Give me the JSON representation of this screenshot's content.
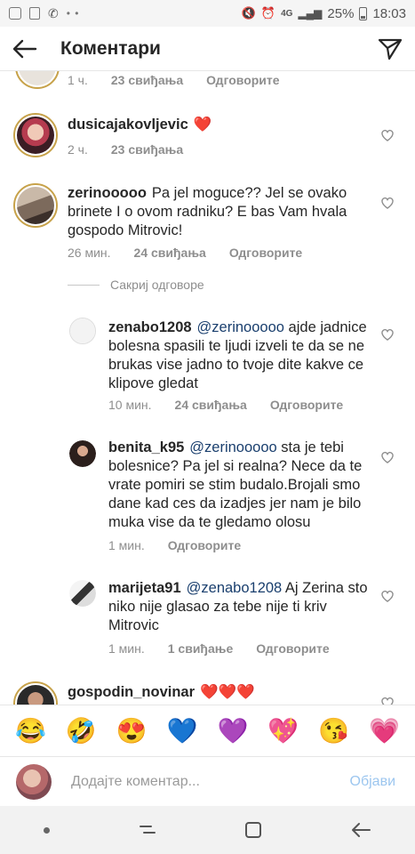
{
  "status_bar": {
    "battery": "25%",
    "time": "18:03",
    "network": "4G"
  },
  "header": {
    "title": "Коментари"
  },
  "comments": [
    {
      "username": "",
      "text": "",
      "time": "1 ч.",
      "likes": "23 свиђања",
      "reply": "Одговорите"
    },
    {
      "username": "dusicajakovljevic",
      "text": "❤️",
      "time": "2 ч.",
      "likes": "23 свиђања",
      "reply": ""
    },
    {
      "username": "zerinooooo",
      "text": "Pa jel moguce?? Jel se ovako brinete I o ovom radniku? E bas Vam hvala gospodo Mitrovic!",
      "time": "26 мин.",
      "likes": "24 свиђања",
      "reply": "Одговорите"
    }
  ],
  "hide_replies": "Сакриј одговоре",
  "replies": [
    {
      "username": "zenabo1208",
      "mention": "@zerinooooo",
      "text_after": "ajde jadnice bolesna spasili te ljudi izveli te da se ne brukas vise jadno to tvoje dite kakve ce klipove gledat",
      "time": "10 мин.",
      "likes": "24 свиђања",
      "reply": "Одговорите"
    },
    {
      "username": "benita_k95",
      "mention": "@zerinooooo",
      "text_after": "sta je tebi bolesnice? Pa jel si realna? Nece da te vrate pomiri se stim budalo.Brojali smo dane kad ces da izadjes jer nam je bilo muka vise da te gledamo olosu",
      "time": "1 мин.",
      "likes": "",
      "reply": "Одговорите"
    },
    {
      "username": "marijeta91",
      "mention": "@zenabo1208",
      "text_after": "Aj Zerina sto niko nije glasao za tebe nije ti kriv Mitrovic",
      "time": "1 мин.",
      "likes": "1 свиђање",
      "reply": "Одговорите"
    }
  ],
  "last_comment": {
    "username": "gospodin_novinar",
    "text": "❤️❤️❤️"
  },
  "emoji_bar": [
    "😂",
    "🤣",
    "😍",
    "💙",
    "💜",
    "💖",
    "😘",
    "💗"
  ],
  "input": {
    "placeholder": "Додајте коментар...",
    "post_label": "Објави"
  }
}
